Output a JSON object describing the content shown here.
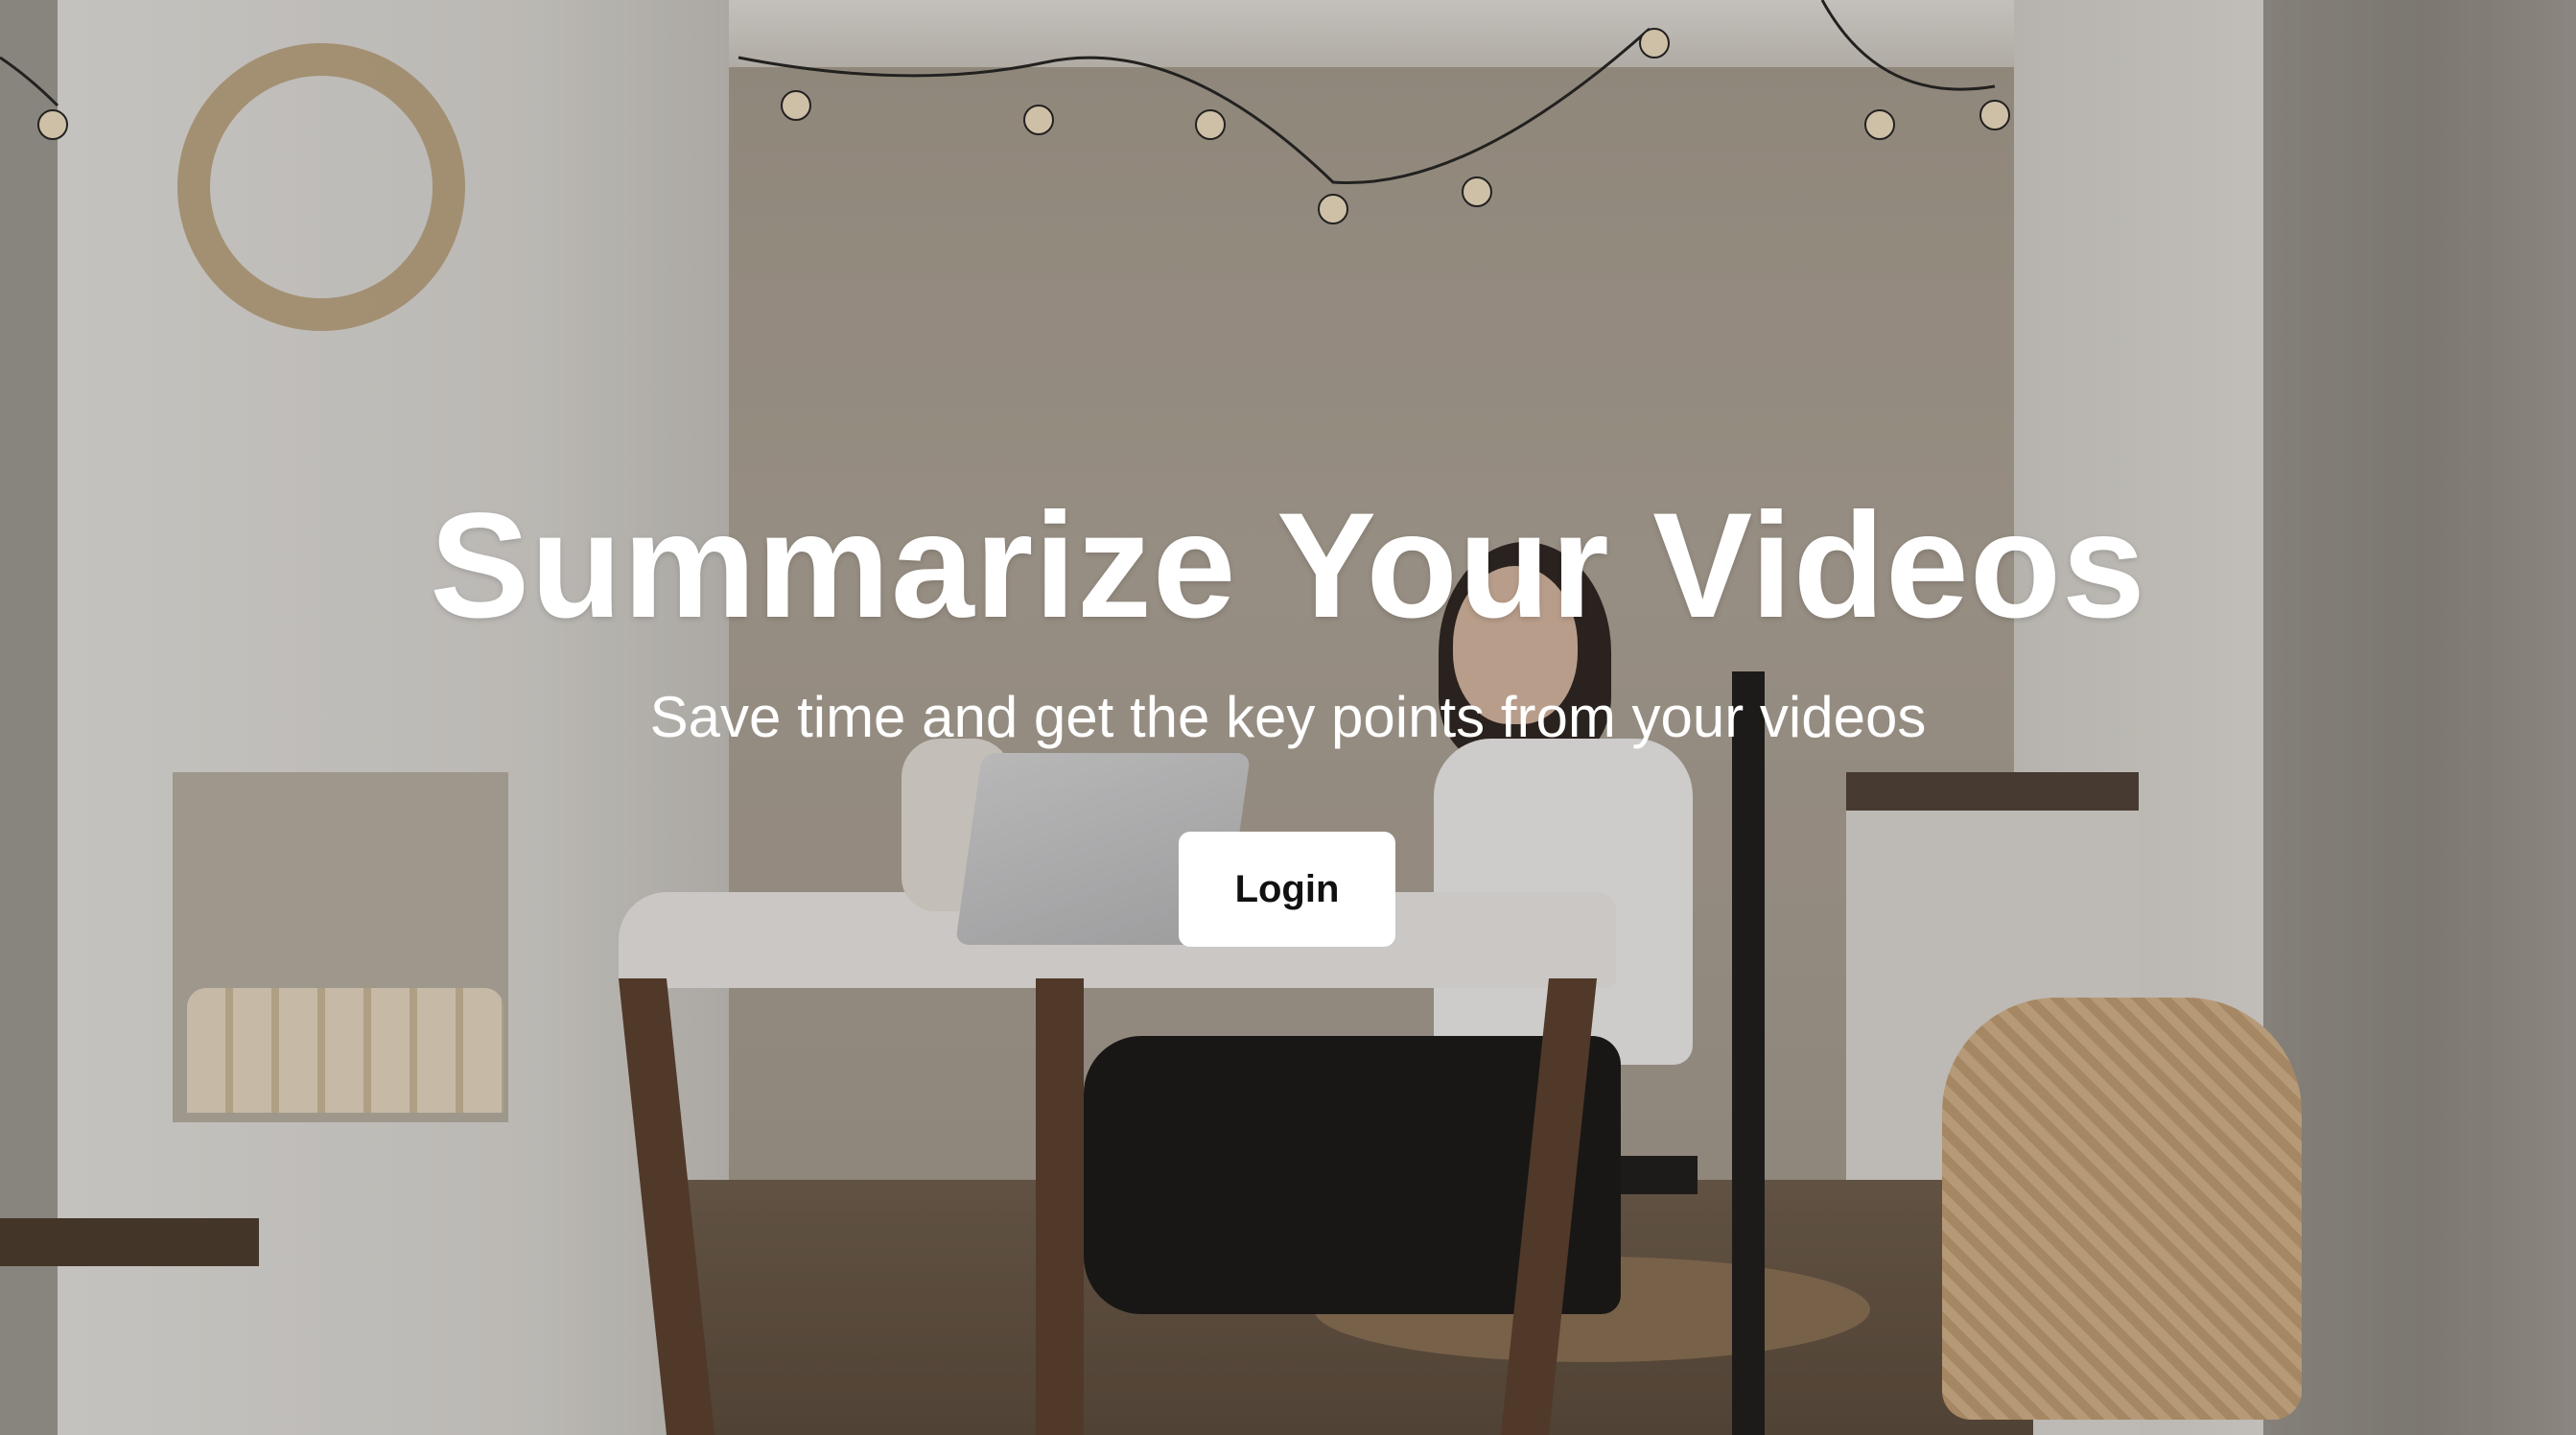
{
  "hero": {
    "title": "Summarize Your Videos",
    "subtitle": "Save time and get the key points from your videos",
    "login_label": "Login",
    "background_image": "woman-at-laptop-kitchen-photo"
  },
  "colors": {
    "title_text": "#ffffff",
    "button_bg": "#ffffff",
    "button_text": "#111111"
  }
}
